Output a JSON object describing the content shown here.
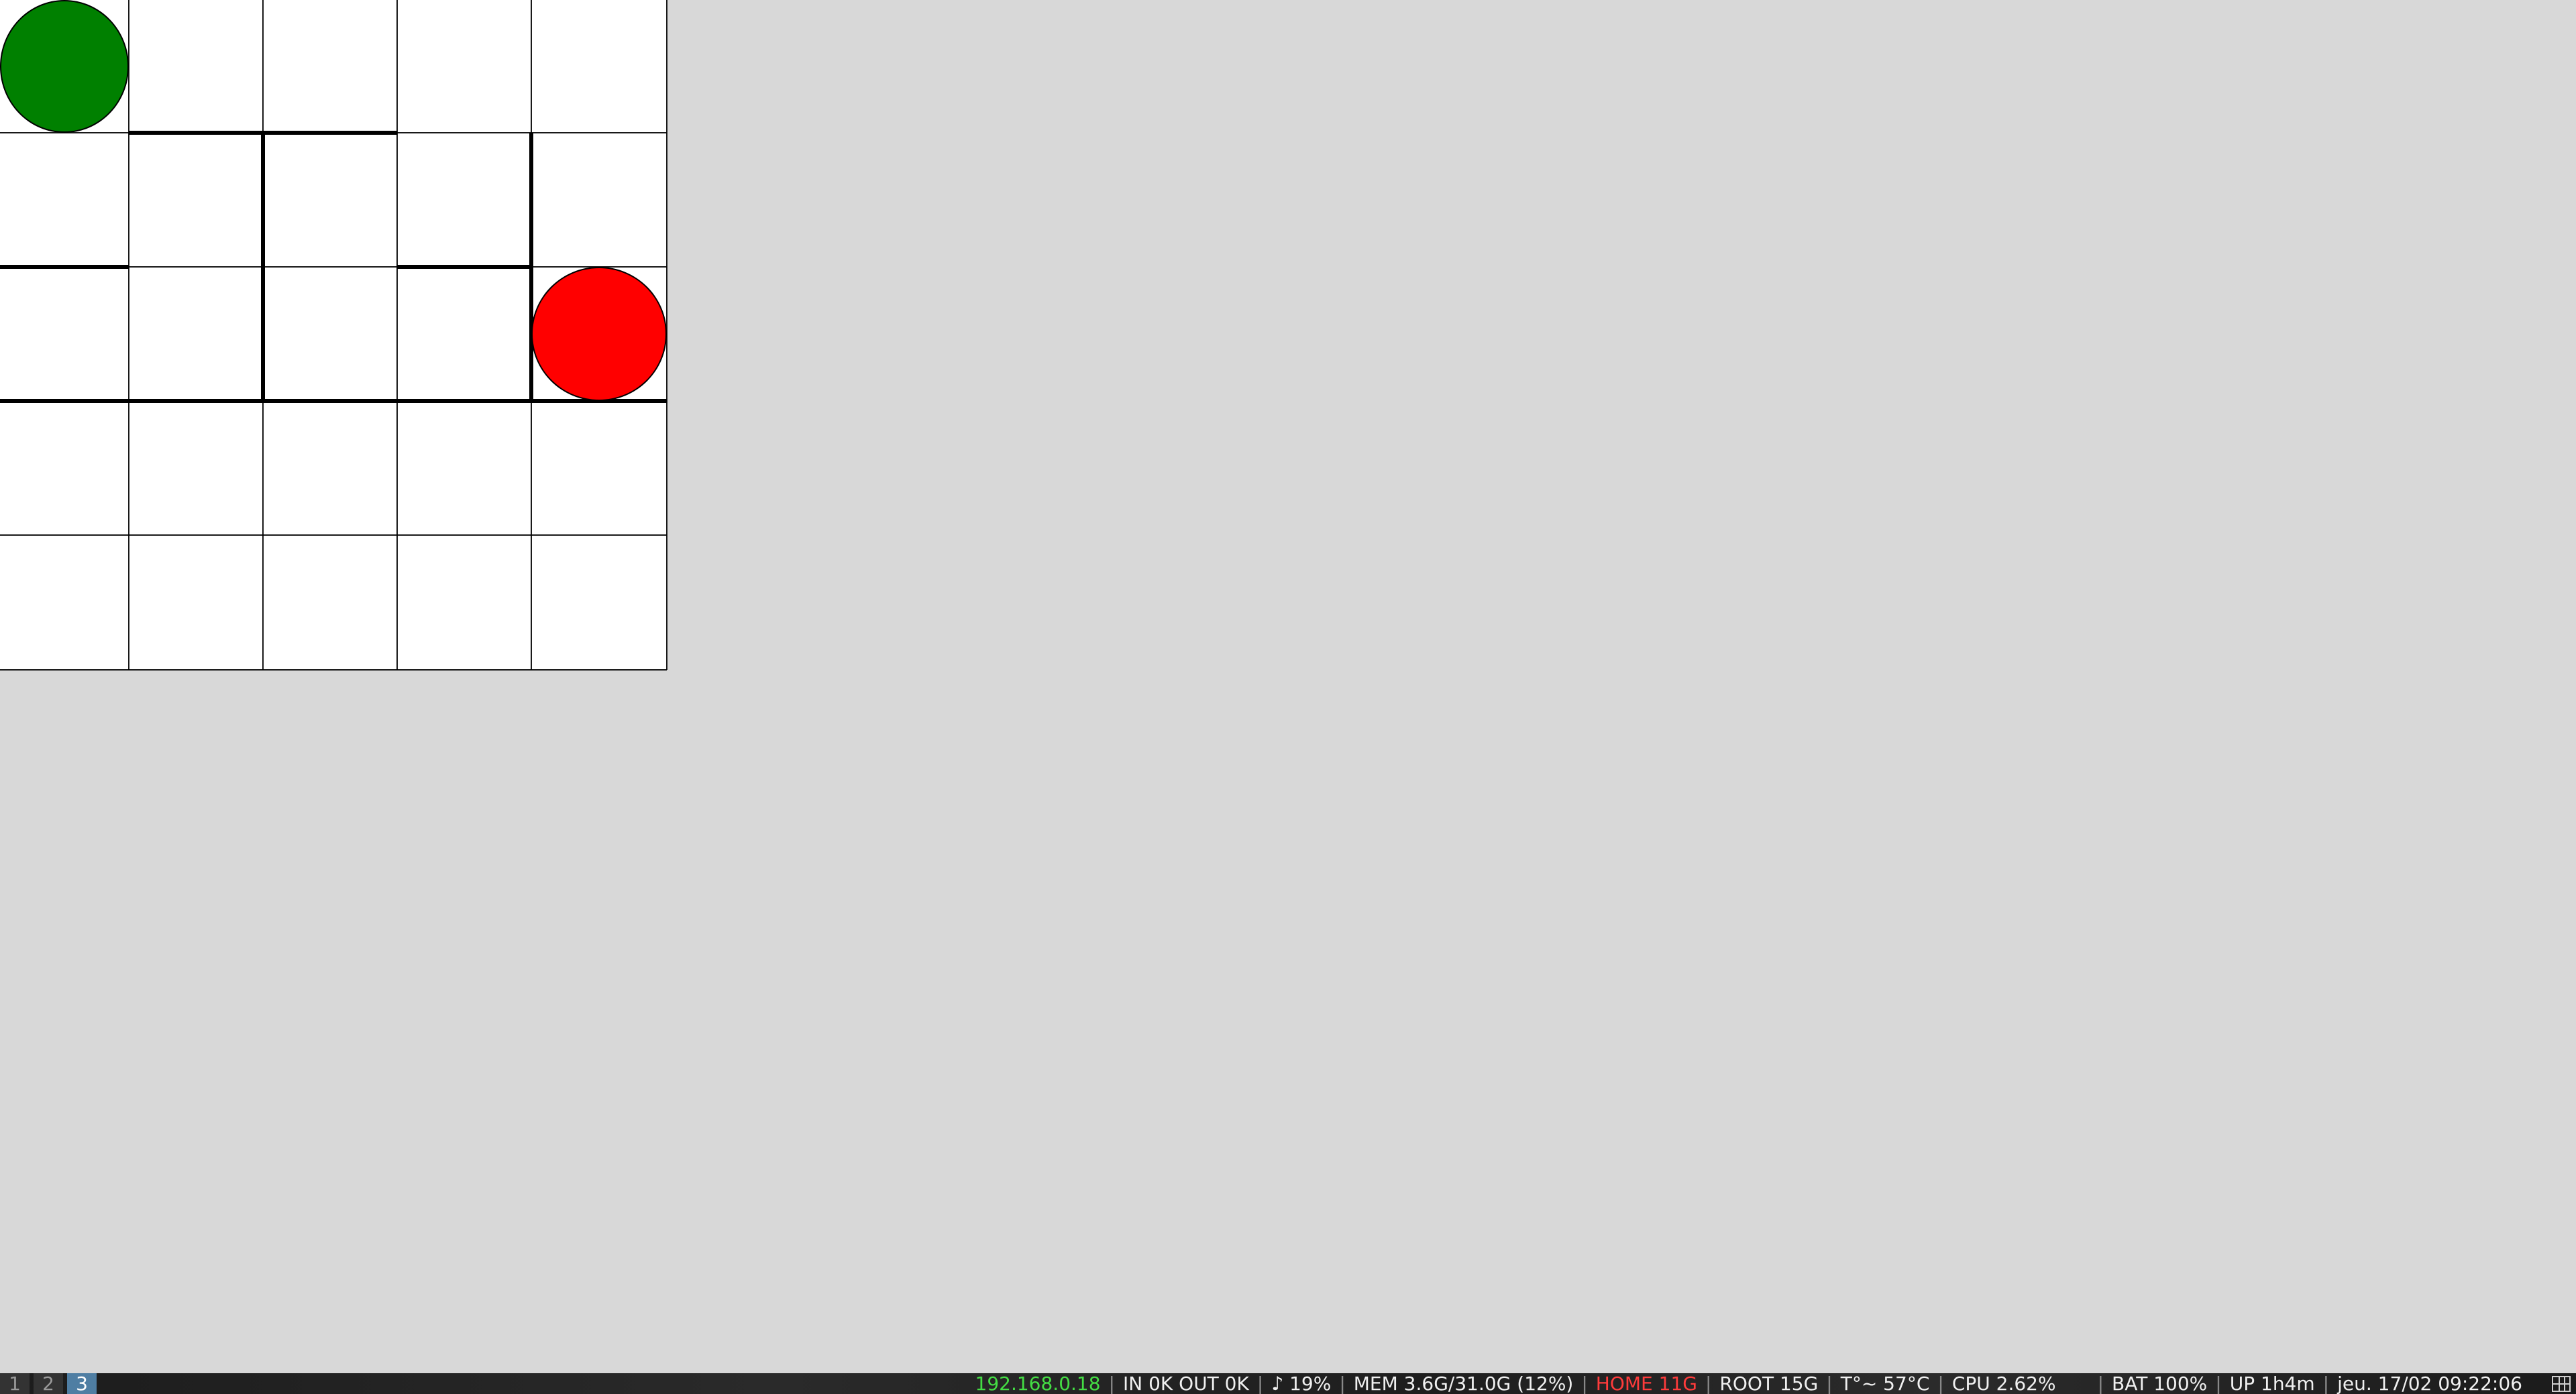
{
  "maze": {
    "rows": 5,
    "cols": 5,
    "start": {
      "row": 0,
      "col": 0,
      "color": "#008000"
    },
    "goal": {
      "row": 2,
      "col": 4,
      "color": "#ff0000"
    },
    "walls": [
      {
        "type": "h",
        "row": 1,
        "col": 1
      },
      {
        "type": "h",
        "row": 1,
        "col": 2
      },
      {
        "type": "v",
        "row": 1,
        "col": 2
      },
      {
        "type": "v",
        "row": 1,
        "col": 4
      },
      {
        "type": "h",
        "row": 2,
        "col": 0
      },
      {
        "type": "h",
        "row": 2,
        "col": 3
      },
      {
        "type": "v",
        "row": 2,
        "col": 2
      },
      {
        "type": "v",
        "row": 2,
        "col": 4
      },
      {
        "type": "h",
        "row": 3,
        "col": 0
      },
      {
        "type": "h",
        "row": 3,
        "col": 1
      },
      {
        "type": "h",
        "row": 3,
        "col": 2
      },
      {
        "type": "h",
        "row": 3,
        "col": 3
      },
      {
        "type": "h",
        "row": 3,
        "col": 4
      }
    ]
  },
  "statusbar": {
    "workspaces": [
      "1",
      "2",
      "3"
    ],
    "active_workspace": "3",
    "ip": "192.168.0.18",
    "ip_color": "#44dd44",
    "net": "IN 0K OUT 0K",
    "volume": "♪ 19%",
    "mem": "MEM 3.6G/31.0G (12%)",
    "home": "HOME 11G",
    "home_color": "#ff3b3b",
    "root": "ROOT 15G",
    "temp": "T°~ 57°C",
    "cpu": "CPU 2.62%",
    "bat": "BAT 100%",
    "uptime": "UP 1h4m",
    "datetime": "jeu. 17/02 09:22:06",
    "tray_icon": "grid-icon"
  }
}
